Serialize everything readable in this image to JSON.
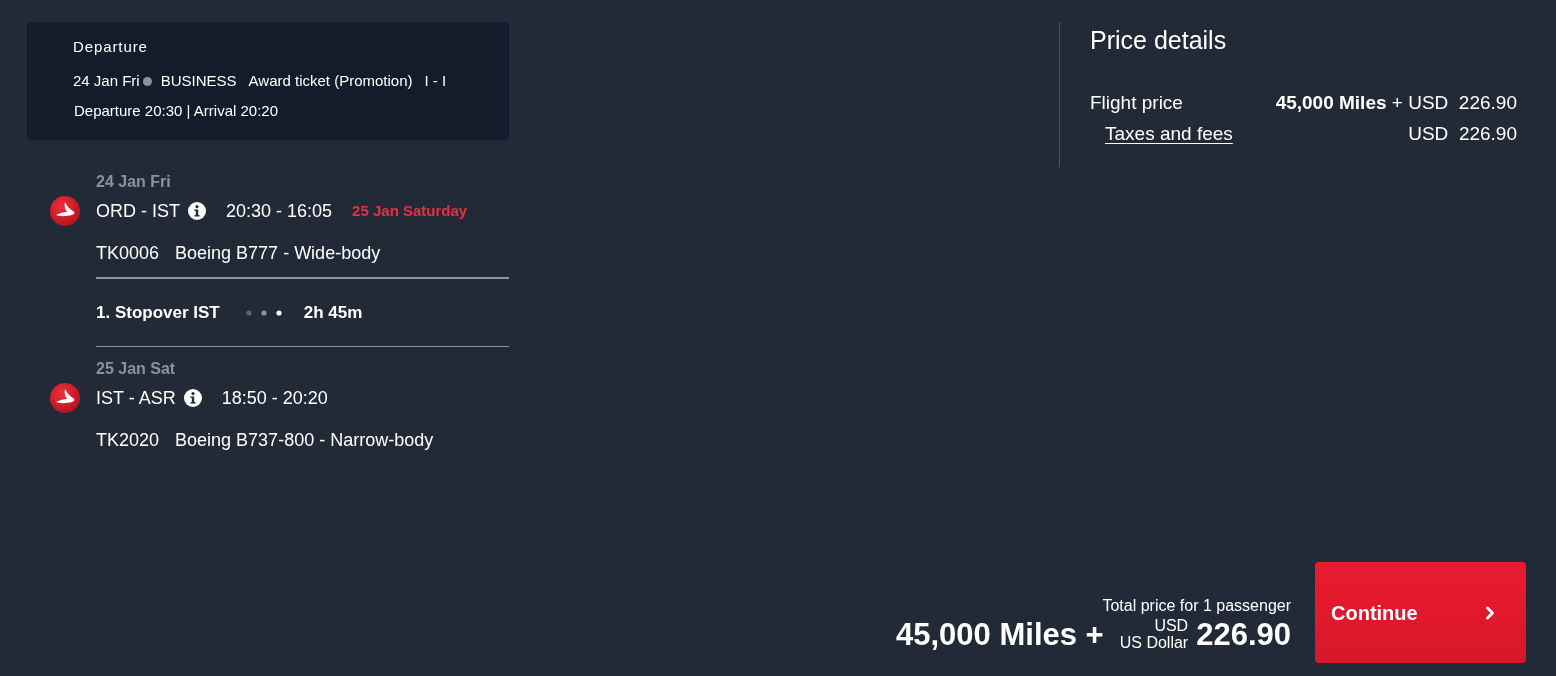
{
  "departure_card": {
    "title": "Departure",
    "date": "24 Jan Fri",
    "cabin": "BUSINESS",
    "fare": "Award ticket (Promotion)",
    "booking_class": "I - I",
    "times": "Departure 20:30 | Arrival 20:20"
  },
  "segments": [
    {
      "kind": "flight",
      "date": "24 Jan Fri",
      "route": "ORD - IST",
      "times": "20:30 - 16:05",
      "arrival_note": "25 Jan Saturday",
      "flight_number": "TK0006",
      "aircraft": "Boeing B777 - Wide-body"
    },
    {
      "kind": "stopover",
      "label": "1. Stopover IST",
      "duration": "2h 45m"
    },
    {
      "kind": "flight",
      "date": "25 Jan Sat",
      "route": "IST - ASR",
      "times": "18:50 - 20:20",
      "flight_number": "TK2020",
      "aircraft": "Boeing B737-800 - Narrow-body"
    }
  ],
  "price_details": {
    "title": "Price details",
    "rows": [
      {
        "kind": "plain",
        "label": "Flight price",
        "value": "**45,000 Miles** + USD  226.90"
      },
      {
        "kind": "link",
        "label": "Taxes and fees",
        "value": "USD  226.90"
      }
    ]
  },
  "total": {
    "label": "Total price for 1 passenger",
    "miles": "45,000 Miles +",
    "currency_code": "USD",
    "currency_name": "US Dollar",
    "amount": "226.90"
  },
  "continue_button": {
    "label": "Continue"
  }
}
